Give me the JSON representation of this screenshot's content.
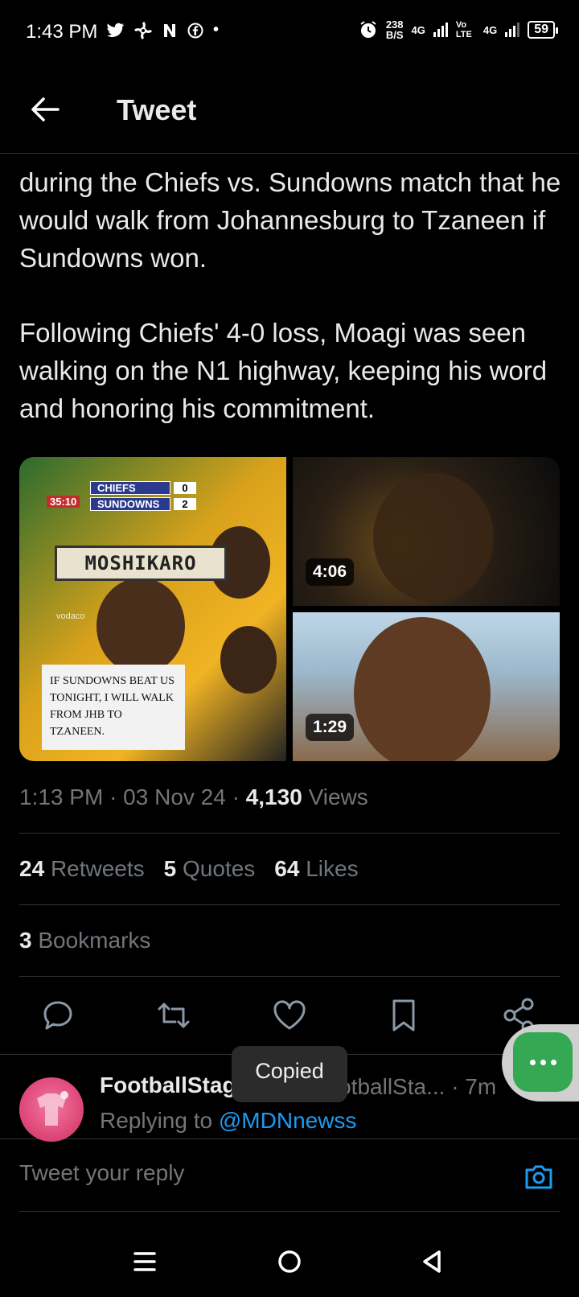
{
  "status_bar": {
    "time": "1:43 PM",
    "notification_icons": [
      "twitter-icon",
      "pinwheel-icon",
      "n-icon",
      "facebook-icon"
    ],
    "dot": "•",
    "net_speed_value": "238",
    "net_speed_unit": "B/S",
    "sim1_label": "4G",
    "volte_label": "Vo LTE",
    "sim2_label": "4G",
    "battery_level": "59"
  },
  "header": {
    "title": "Tweet"
  },
  "tweet": {
    "text_paragraph_1": "during the Chiefs vs. Sundowns match that he would walk from Johannesburg to Tzaneen if Sundowns won.",
    "text_paragraph_2": "Following Chiefs' 4-0 loss, Moagi was seen walking on the N1 highway, keeping his word and honoring his commitment.",
    "media": {
      "photo": {
        "scoreboard_team_1": "CHIEFS",
        "scoreboard_score_1": "0",
        "scoreboard_team_2": "SUNDOWNS",
        "scoreboard_score_2": "2",
        "scoreboard_clock": "35:10",
        "hat_label": "MOSHIKARO",
        "sponsor": "vodaco",
        "sign_text": "IF SUNDOWNS BEAT US TONIGHT, I WILL WALK FROM JHB TO TZANEEN."
      },
      "video_1_duration": "4:06",
      "video_2_duration": "1:29"
    },
    "time": "1:13 PM",
    "date": "03 Nov 24",
    "views_count": "4,130",
    "views_label": "Views",
    "separator": "·",
    "retweets_count": "24",
    "retweets_label": "Retweets",
    "quotes_count": "5",
    "quotes_label": "Quotes",
    "likes_count": "64",
    "likes_label": "Likes",
    "bookmarks_count": "3",
    "bookmarks_label": "Bookmarks"
  },
  "actions": [
    "reply-icon",
    "retweet-icon",
    "like-icon",
    "bookmark-icon",
    "share-icon"
  ],
  "reply": {
    "name": "FootballStage",
    "handle": "@FootballSta...",
    "time": "· 7m",
    "replying_prefix": "Replying to",
    "replying_handle": "@MDNnewss"
  },
  "toast": {
    "text": "Copied"
  },
  "compose": {
    "placeholder": "Tweet your reply"
  },
  "colors": {
    "background": "#000000",
    "text": "#e7e9ea",
    "muted": "#71767b",
    "accent": "#1d9bf0",
    "divider": "#2f3336",
    "fab": "#34a853"
  }
}
